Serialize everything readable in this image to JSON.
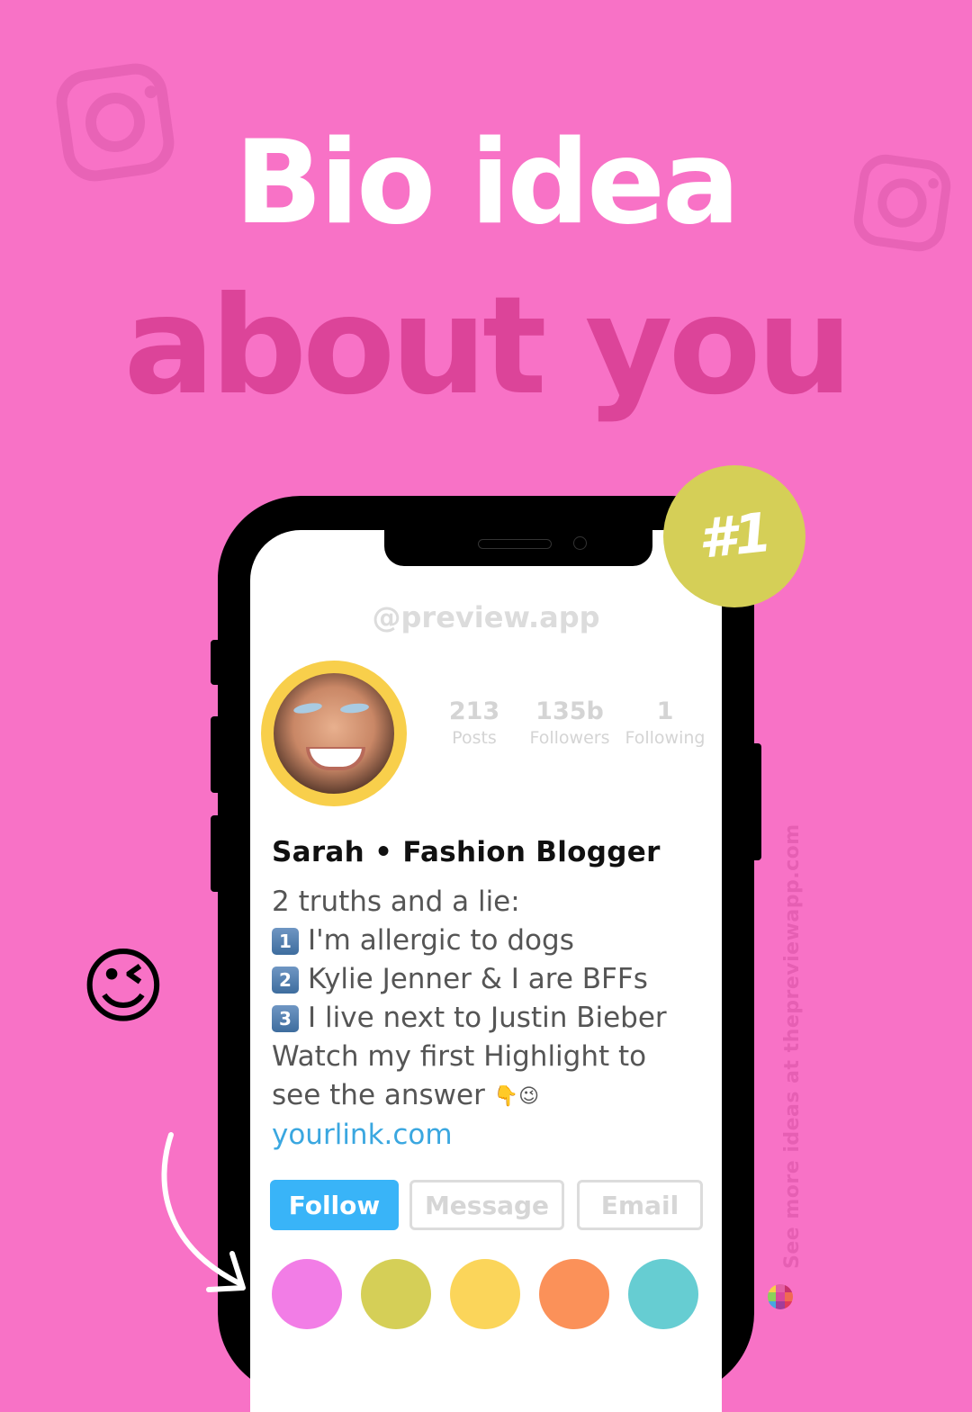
{
  "headline": {
    "line1": "Bio idea",
    "line2": "about you"
  },
  "badge": {
    "label": "#1",
    "color": "#d5cf57"
  },
  "profile": {
    "handle": "@preview.app",
    "stats": [
      {
        "value": "213",
        "label": "Posts"
      },
      {
        "value": "135b",
        "label": "Followers"
      },
      {
        "value": "1",
        "label": "Following"
      }
    ],
    "name": "Sarah • Fashion Blogger",
    "bio": {
      "intro": "2 truths and a lie:",
      "items": [
        {
          "key": "1",
          "text": "I'm allergic to dogs"
        },
        {
          "key": "2",
          "text": "Kylie Jenner & I are BFFs"
        },
        {
          "key": "3",
          "text": "I live next to Justin Bieber"
        }
      ],
      "line5": "Watch my first Highlight to",
      "line6": "see the answer",
      "line6_emojis": "👇😉",
      "link": "yourlink.com"
    },
    "buttons": {
      "follow": "Follow",
      "message": "Message",
      "email": "Email"
    },
    "highlight_colors": [
      "#f27de6",
      "#d5cf57",
      "#fbd55a",
      "#fb9159",
      "#66cdd2"
    ]
  },
  "decor": {
    "wink_emoji": "😉",
    "side_text": "See more ideas at thepreviewapp.com"
  },
  "colors": {
    "background": "#f872c6",
    "accent_pink": "#dc4499",
    "follow_blue": "#39b4f8",
    "link_blue": "#3aa7e0",
    "avatar_ring": "#f8cf4b"
  }
}
